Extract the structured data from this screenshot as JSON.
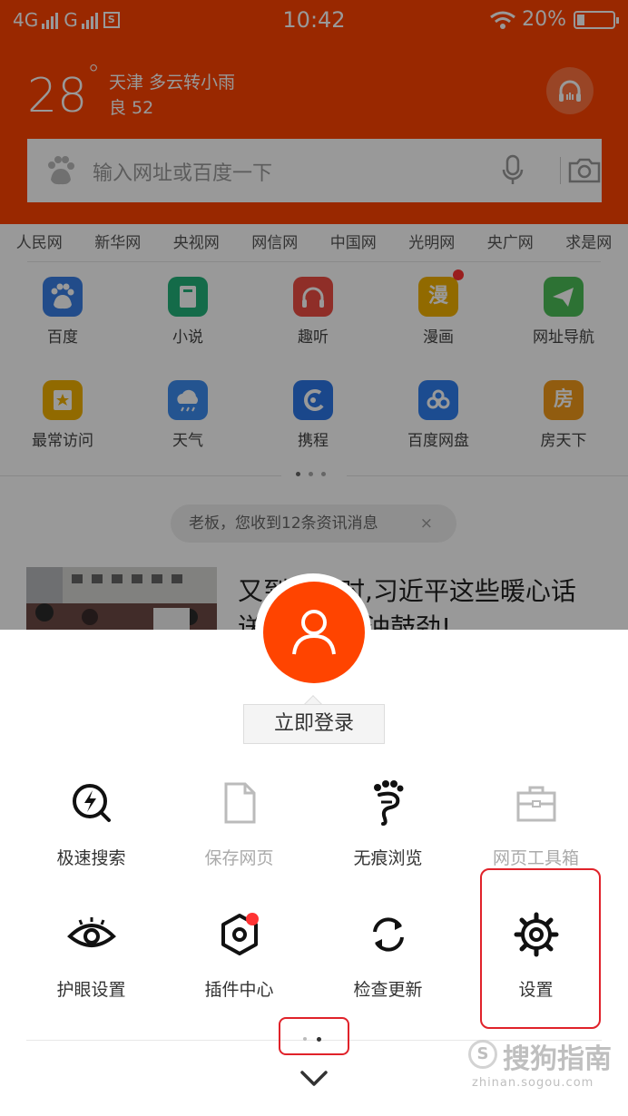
{
  "status_bar": {
    "network1": "4G",
    "network2": "G",
    "sim_glyph": "S",
    "time": "10:42",
    "battery": "20%",
    "battery_level": 0.2
  },
  "weather": {
    "temperature": "28",
    "degree": "°",
    "location_condition": "天津 多云转小雨",
    "air_quality": "良 52"
  },
  "search": {
    "placeholder": "输入网址或百度一下"
  },
  "quick_links": [
    "人民网",
    "新华网",
    "央视网",
    "网信网",
    "中国网",
    "光明网",
    "央广网",
    "求是网"
  ],
  "apps": [
    {
      "label": "百度",
      "icon": "baidu-paw-icon",
      "color": "#3a7fe6"
    },
    {
      "label": "小说",
      "icon": "book-icon",
      "color": "#22b37a"
    },
    {
      "label": "趣听",
      "icon": "headphones-icon",
      "color": "#ee4d44"
    },
    {
      "label": "漫画",
      "icon": "comic-icon",
      "glyph": "漫",
      "color": "#f2b100",
      "badge": true
    },
    {
      "label": "网址导航",
      "icon": "paper-plane-icon",
      "color": "#4cbf57"
    },
    {
      "label": "最常访问",
      "icon": "star-icon",
      "color": "#f2b100"
    },
    {
      "label": "天气",
      "icon": "cloud-rain-icon",
      "color": "#3d8df0"
    },
    {
      "label": "携程",
      "icon": "ctrip-icon",
      "color": "#2c77e8"
    },
    {
      "label": "百度网盘",
      "icon": "cloud-disk-icon",
      "color": "#2f7ff0"
    },
    {
      "label": "房天下",
      "icon": "house-icon",
      "glyph": "房",
      "color": "#f29a1a"
    }
  ],
  "notice": {
    "text": "老板，您收到12条资讯消息",
    "close": "×"
  },
  "news": {
    "title": "又到高考时,习近平这些暖心话送给学子加油鼓劲!"
  },
  "account": {
    "login_label": "立即登录"
  },
  "menu": [
    {
      "label": "极速搜索",
      "icon": "lightning-search-icon",
      "enabled": true
    },
    {
      "label": "保存网页",
      "icon": "document-icon",
      "enabled": false
    },
    {
      "label": "无痕浏览",
      "icon": "footprint-icon",
      "enabled": true
    },
    {
      "label": "网页工具箱",
      "icon": "toolbox-icon",
      "enabled": false
    },
    {
      "label": "护眼设置",
      "icon": "eye-icon",
      "enabled": true
    },
    {
      "label": "插件中心",
      "icon": "plugin-hexagon-icon",
      "enabled": true,
      "badge": true
    },
    {
      "label": "检查更新",
      "icon": "refresh-icon",
      "enabled": true
    },
    {
      "label": "设置",
      "icon": "gear-icon",
      "enabled": true
    }
  ],
  "pager": {
    "pages": 2,
    "current": 2
  },
  "watermark": {
    "glyph": "S",
    "brand": "搜狗指南",
    "url": "zhinan.sogou.com"
  },
  "colors": {
    "brand": "#ff4400",
    "highlight": "#e0222a"
  }
}
